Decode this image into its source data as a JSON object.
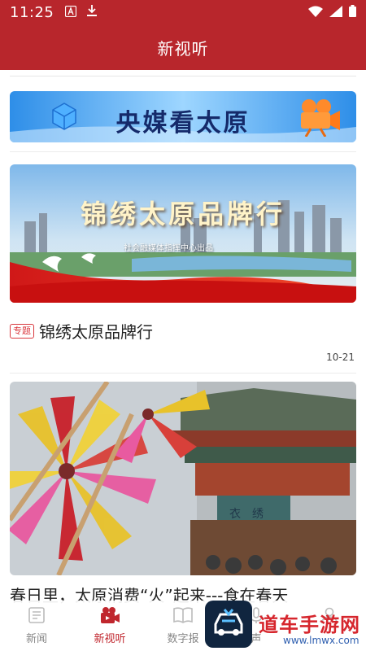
{
  "status_bar": {
    "time": "11:25"
  },
  "header": {
    "title": "新视听"
  },
  "banner": {
    "text": "央媒看太原"
  },
  "article1": {
    "image_title": "锦绣太原品牌行",
    "image_subtitle": "社会融媒体指挥中心出品",
    "tag": "专题",
    "title": "锦绣太原品牌行",
    "date": "10-21"
  },
  "article2": {
    "plaque": "衣绣",
    "title": "春日里，太原消费“火”起来---食在春天"
  },
  "bottom_nav": {
    "items": [
      {
        "label": "新闻",
        "icon": "news-icon",
        "active": false
      },
      {
        "label": "新视听",
        "icon": "video-icon",
        "active": true
      },
      {
        "label": "数字报",
        "icon": "newspaper-icon",
        "active": false
      },
      {
        "label": "声",
        "icon": "audio-icon",
        "active": false
      },
      {
        "label": "",
        "icon": "profile-icon",
        "active": false
      }
    ]
  },
  "watermark": {
    "text": "道车手游网",
    "url": "www.lmwx.com"
  },
  "colors": {
    "brand_red": "#b8262c",
    "tag_red": "#d9383e",
    "active_red": "#c0262d"
  }
}
